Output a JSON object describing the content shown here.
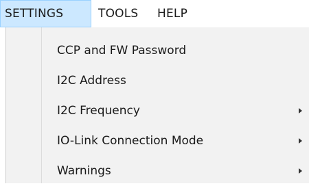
{
  "menubar": {
    "items": [
      {
        "label": "SETTINGS"
      },
      {
        "label": "TOOLS"
      },
      {
        "label": "HELP"
      }
    ]
  },
  "settings_menu": {
    "items": [
      {
        "label": "CCP and FW Password",
        "has_submenu": false
      },
      {
        "label": "I2C Address",
        "has_submenu": false
      },
      {
        "label": "I2C Frequency",
        "has_submenu": true
      },
      {
        "label": "IO-Link Connection Mode",
        "has_submenu": true
      },
      {
        "label": "Warnings",
        "has_submenu": true
      }
    ]
  },
  "colors": {
    "active_menu_bg": "#cce8ff",
    "active_menu_border": "#99d1ff",
    "dropdown_bg": "#f2f2f2"
  }
}
